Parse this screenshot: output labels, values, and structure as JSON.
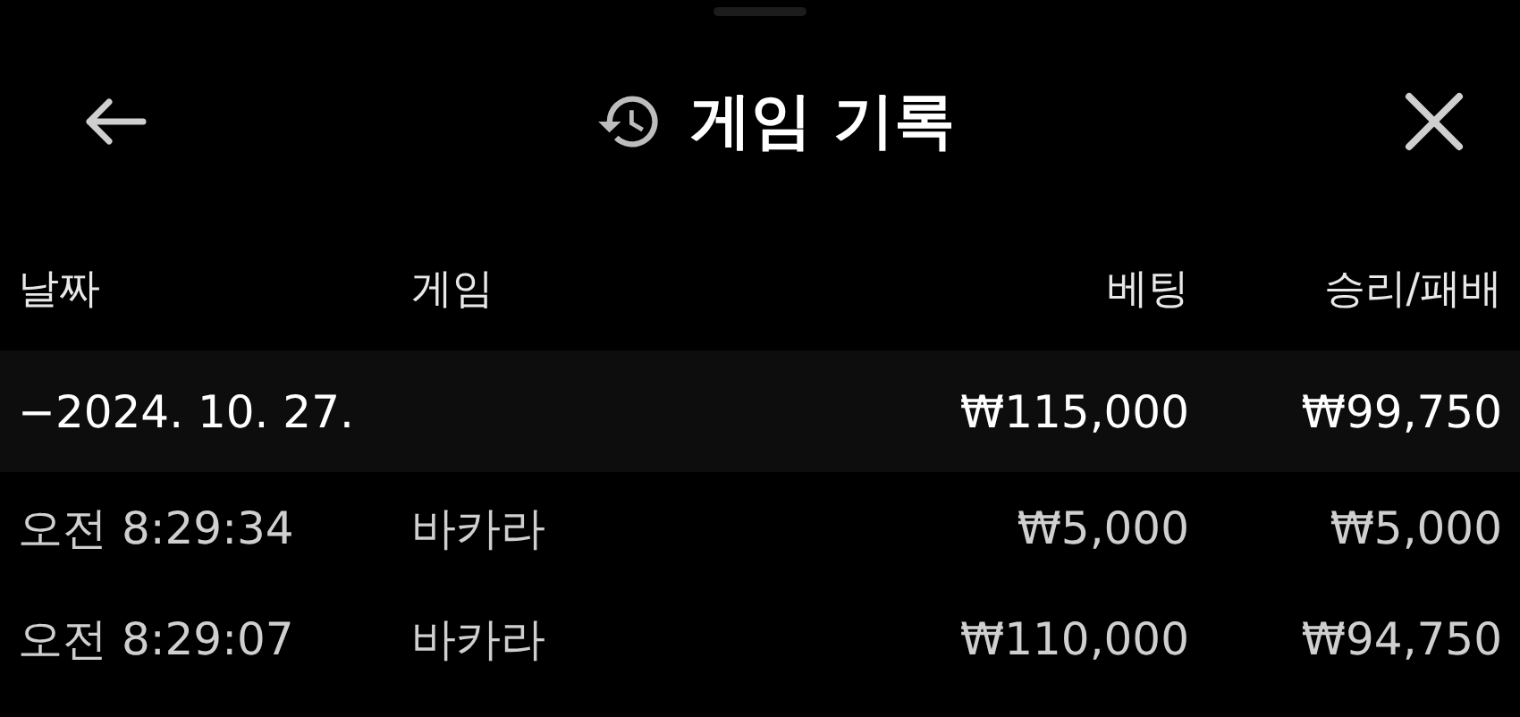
{
  "header": {
    "title": "게임 기록"
  },
  "table": {
    "columns": [
      "날짜",
      "게임",
      "베팅",
      "승리/패배"
    ],
    "groups": [
      {
        "toggle": "−",
        "date": "2024. 10. 27.",
        "bet": "₩115,000",
        "result": "₩99,750",
        "rows": [
          {
            "time": "오전 8:29:34",
            "game": "바카라",
            "bet": "₩5,000",
            "result": "₩5,000"
          },
          {
            "time": "오전 8:29:07",
            "game": "바카라",
            "bet": "₩110,000",
            "result": "₩94,750"
          }
        ]
      }
    ]
  }
}
